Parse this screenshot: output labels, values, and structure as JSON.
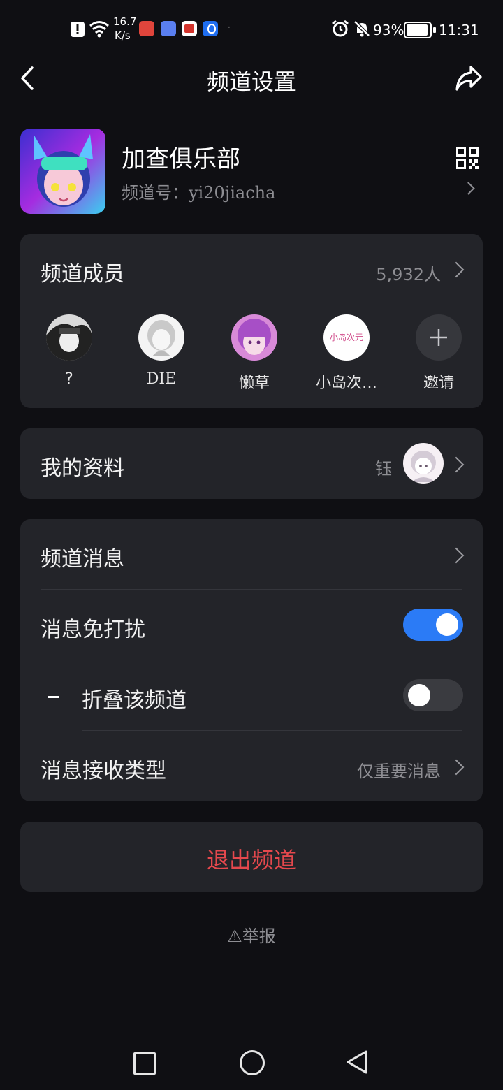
{
  "status_bar": {
    "net_speed_value": "16.7",
    "net_speed_unit": "K/s",
    "battery": "93%",
    "time": "11:31"
  },
  "header": {
    "title": "频道设置",
    "back_icon": "back-arrow-icon",
    "share_icon": "share-icon"
  },
  "channel": {
    "name": "加查俱乐部",
    "id_text": "频道号：yi20jiacha",
    "qr_icon": "qr-code-icon"
  },
  "members": {
    "label": "频道成员",
    "count": "5,932人",
    "list": [
      {
        "name": "?"
      },
      {
        "name": "DIE"
      },
      {
        "name": "懒草"
      },
      {
        "name": "小岛次…",
        "avatar_text": "小岛次元"
      }
    ],
    "invite_label": "邀请"
  },
  "profile": {
    "label": "我的资料",
    "nickname": "钰"
  },
  "settings": {
    "channel_messages": "频道消息",
    "dnd_label": "消息免打扰",
    "dnd_on": true,
    "fold_label": "折叠该频道",
    "fold_on": false,
    "receive_type_label": "消息接收类型",
    "receive_type_value": "仅重要消息"
  },
  "exit_label": "退出频道",
  "report_label": "⚠举报",
  "colors": {
    "background": "#0f0f13",
    "card": "#232429",
    "toggle_on": "#2b7bf6",
    "toggle_off": "#3a3b40",
    "danger": "#e5484d"
  }
}
